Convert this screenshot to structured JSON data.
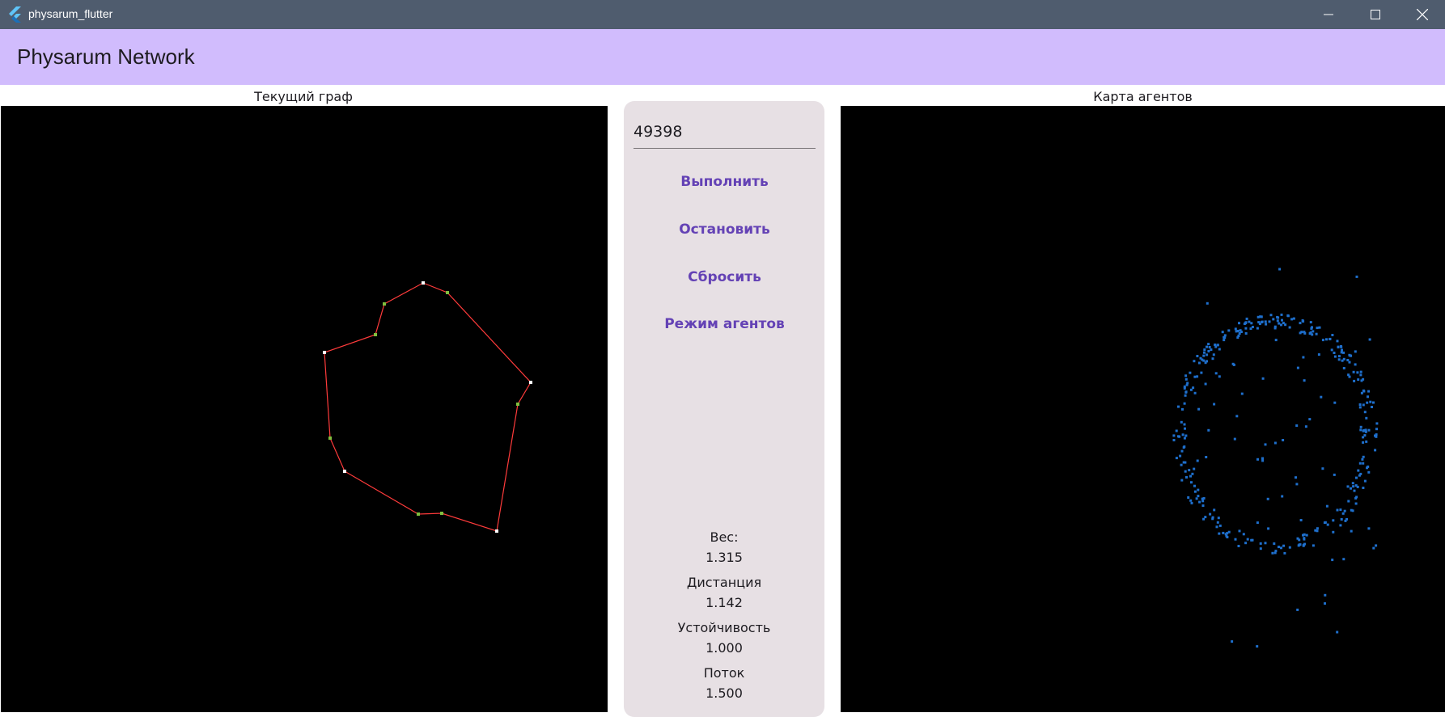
{
  "window": {
    "title": "physarum_flutter",
    "controls": {
      "minimize": "minimize-icon",
      "maximize": "maximize-icon",
      "close": "close-icon"
    }
  },
  "appbar": {
    "title": "Physarum Network"
  },
  "left_panel": {
    "label": "Текущий граф"
  },
  "right_panel": {
    "label": "Карта агентов"
  },
  "controls": {
    "iterations_value": "49398",
    "buttons": {
      "run": "Выполнить",
      "stop": "Остановить",
      "reset": "Сбросить",
      "agents_mode": "Режим агентов"
    }
  },
  "stats": {
    "weight_label": "Вес:",
    "weight_value": "1.315",
    "distance_label": "Дистанция",
    "distance_value": "1.142",
    "stability_label": "Устойчивость",
    "stability_value": "1.000",
    "flow_label": "Поток",
    "flow_value": "1.500"
  },
  "colors": {
    "titlebar": "#4f5c6e",
    "appbar": "#d1bcfd",
    "panel": "#e7e0e4",
    "button_text": "#6442b5",
    "graph_edge": "#ff3b3b",
    "agent": "#1e6fcc"
  }
}
